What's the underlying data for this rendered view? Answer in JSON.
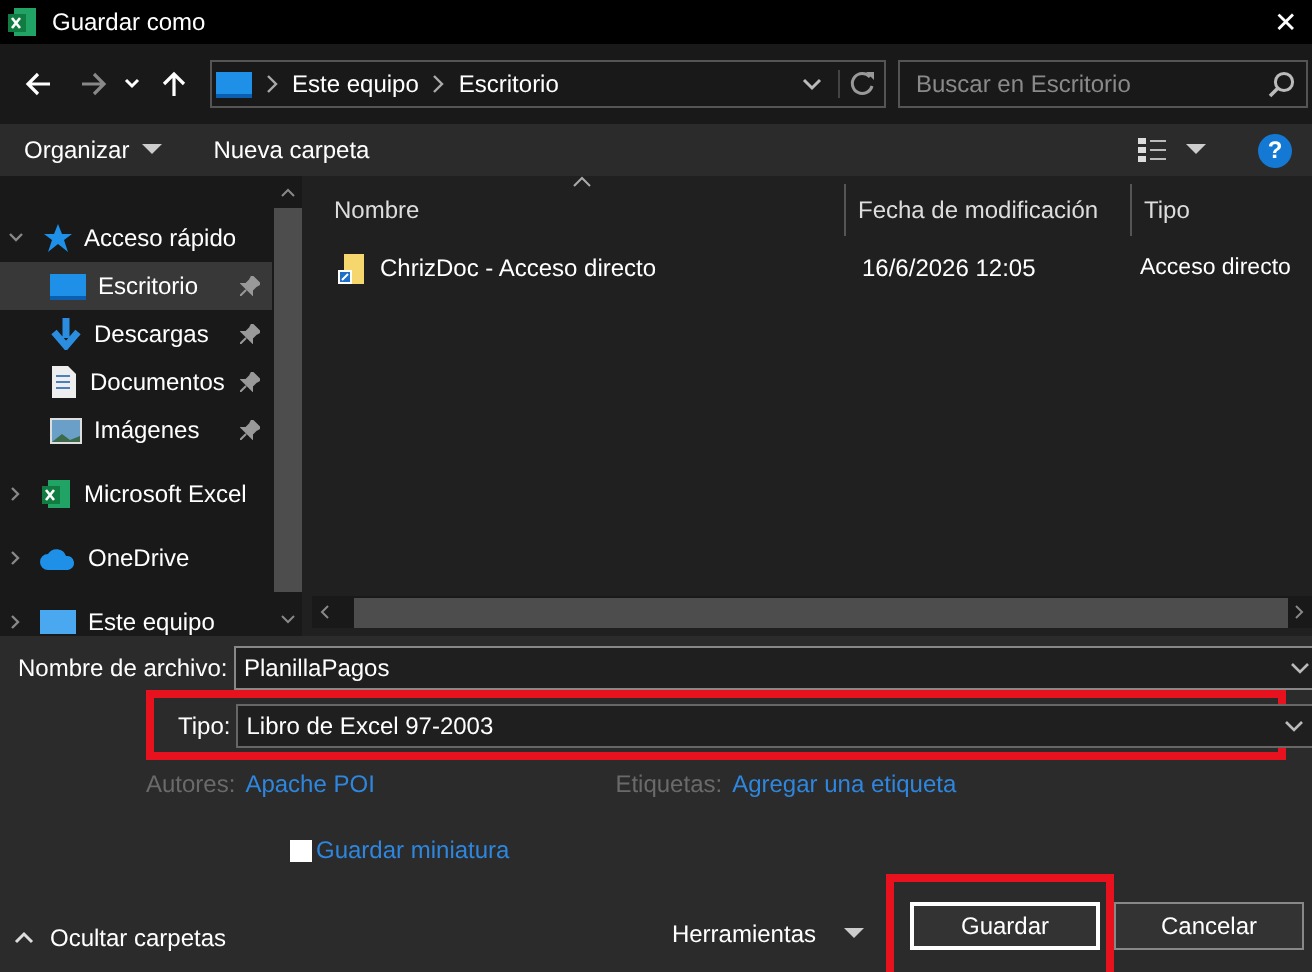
{
  "window": {
    "title": "Guardar como",
    "close": "✕"
  },
  "nav": {
    "breadcrumb": [
      "Este equipo",
      "Escritorio"
    ],
    "search": {
      "placeholder": "Buscar en Escritorio"
    }
  },
  "toolbar": {
    "organize": "Organizar",
    "new_folder": "Nueva carpeta",
    "help": "?"
  },
  "sidebar": {
    "items": [
      {
        "label": "Acceso rápido",
        "kind": "star",
        "expanded": true,
        "children": [
          {
            "label": "Escritorio",
            "kind": "desktop",
            "pinned": true,
            "selected": true
          },
          {
            "label": "Descargas",
            "kind": "download",
            "pinned": true,
            "selected": false
          },
          {
            "label": "Documentos",
            "kind": "document",
            "pinned": true,
            "selected": false
          },
          {
            "label": "Imágenes",
            "kind": "image",
            "pinned": true,
            "selected": false
          }
        ]
      },
      {
        "label": "Microsoft Excel",
        "kind": "excel",
        "expanded": false
      },
      {
        "label": "OneDrive",
        "kind": "cloud",
        "expanded": false
      },
      {
        "label": "Este equipo",
        "kind": "computer",
        "expanded": false
      }
    ]
  },
  "table": {
    "columns": [
      {
        "label": "Nombre",
        "sorted": true
      },
      {
        "label": "Fecha de modificación",
        "sorted": false
      },
      {
        "label": "Tipo",
        "sorted": false
      }
    ],
    "rows": [
      {
        "name": "ChrizDoc - Acceso directo",
        "date": "16/6/2026 12:05",
        "type": "Acceso directo"
      }
    ]
  },
  "form": {
    "file_name": {
      "label": "Nombre de archivo:",
      "value": "PlanillaPagos"
    },
    "file_type": {
      "label": "Tipo:",
      "value": "Libro de Excel 97-2003",
      "highlighted": true
    },
    "authors": {
      "label": "Autores:",
      "value": "Apache POI"
    },
    "tags": {
      "label": "Etiquetas:",
      "value": "Agregar una etiqueta"
    },
    "thumbnail": {
      "label": "Guardar miniatura",
      "checked": false
    }
  },
  "footer": {
    "hide_folders": "Ocultar carpetas",
    "tools": "Herramientas",
    "buttons": [
      {
        "label": "Guardar",
        "kind": "primary",
        "highlighted": true
      },
      {
        "label": "Cancelar",
        "kind": "normal",
        "highlighted": false
      }
    ]
  }
}
